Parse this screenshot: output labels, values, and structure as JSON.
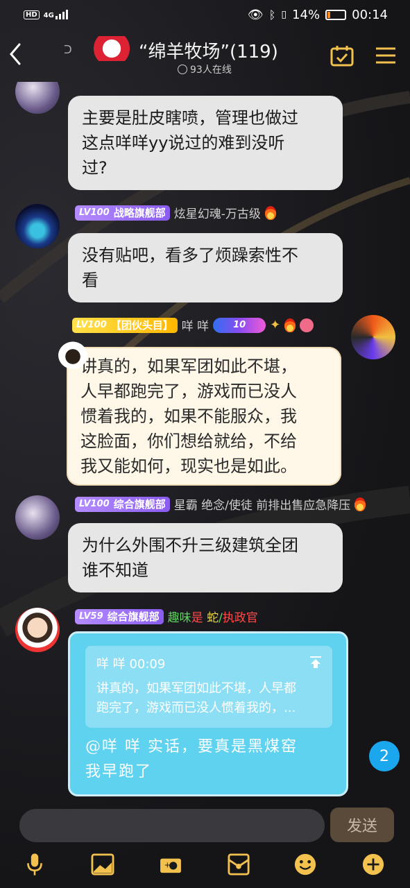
{
  "status_bar": {
    "left_badges": [
      "HD",
      "4G"
    ],
    "battery_pct": "14%",
    "time": "00:14"
  },
  "header": {
    "title": "“绵羊牧场”(119)",
    "online": "93人在线"
  },
  "messages": [
    {
      "lines": [
        "主要是肚皮瞎喷，管理也做过",
        "这点咩咩yy说过的难到没听",
        "过?"
      ]
    },
    {
      "level": "LV100",
      "tag": "战略旗舰部",
      "name": "炫星幻魂-万古级",
      "lines": [
        "没有贴吧，看多了烦躁索性不",
        "看"
      ]
    },
    {
      "level": "LV100",
      "tag": "【团伙头目】",
      "name": "咩 咩",
      "badge_num": "10",
      "lines": [
        "讲真的，如果军团如此不堪，",
        "人早都跑完了，游戏而已没人",
        "惯着我的，如果不能服众，我",
        "这脸面，你们想给就给，不给",
        "我又能如何，现实也是如此。"
      ]
    },
    {
      "level": "LV100",
      "tag": "综合旗舰部",
      "name": "星霸 绝念/使徒 前排出售应急降压",
      "lines": [
        "为什么外围不升三级建筑全团",
        "谁不知道"
      ]
    },
    {
      "level": "LV59",
      "tag": "综合旗舰部",
      "name_parts": [
        "趣味",
        "是",
        " 蛇",
        "/",
        "执政官"
      ],
      "quote_who": "咩 咩 00:09",
      "quote_lines": [
        "讲真的，如果军团如此不堪，人早都",
        "跑完了，游戏而已没人惯着我的，..."
      ],
      "reply_lines": [
        "@咩 咩 实话，要真是黑煤窑",
        "我早跑了"
      ]
    }
  ],
  "unread_count": "2",
  "input": {
    "placeholder": "",
    "send_label": "发送"
  },
  "colors": {
    "bubble": "#e6e6e6",
    "quote_bubble": "#fff7e8",
    "blue_bubble": "#5fd2ef",
    "level_badge": "#9b6cf5",
    "gold_badge": "#ffc107",
    "unread": "#1aa7ee"
  }
}
